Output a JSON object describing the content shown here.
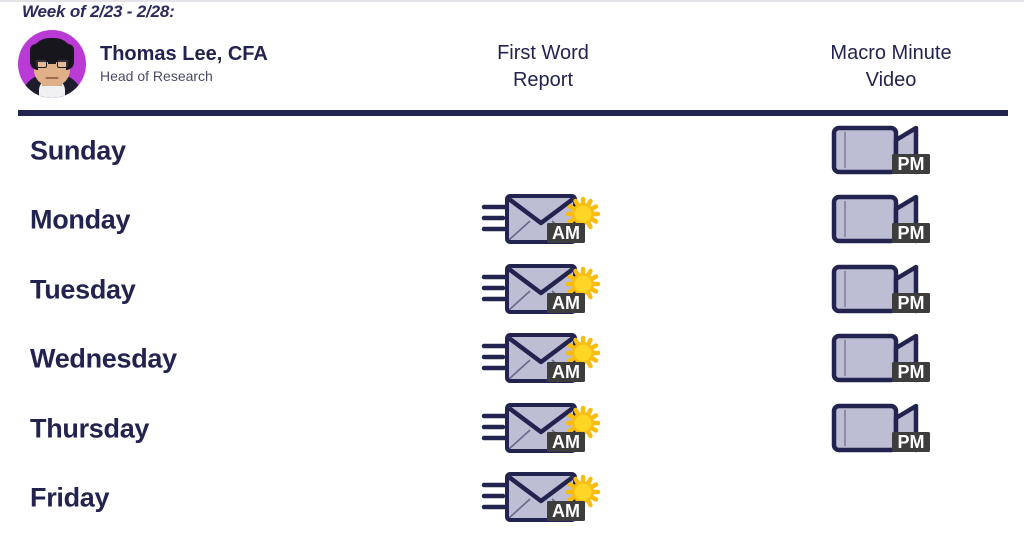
{
  "header": {
    "week_label": "Week of 2/23 - 2/28:",
    "analyst": {
      "name": "Thomas Lee, CFA",
      "title": "Head of Research",
      "avatar_icon": "analyst-avatar",
      "avatar_bg_color": "#b93ad4"
    },
    "columns": [
      {
        "id": "first-word-report",
        "label": "First Word\nReport"
      },
      {
        "id": "macro-minute-video",
        "label": "Macro Minute\nVideo"
      }
    ],
    "rule_color": "#23234f"
  },
  "icons": {
    "email_am": {
      "name": "email-am-icon",
      "badge": "AM",
      "accessory": "sun-icon",
      "envelope_fill": "#bdbdd4",
      "outline": "#23234f",
      "badge_bg": "#3d3d3d",
      "sun_color": "#fbbc10",
      "sun_center": "#ffd526"
    },
    "video_pm": {
      "name": "video-pm-icon",
      "badge": "PM",
      "accessory": "moon-icon",
      "camera_fill": "#bdbdd4",
      "outline": "#23234f",
      "badge_bg": "#3d3d3d",
      "moon_color": "#3fa9f5"
    }
  },
  "schedule": {
    "rows": [
      {
        "day": "Sunday",
        "first_word_report": false,
        "macro_minute_video": true
      },
      {
        "day": "Monday",
        "first_word_report": true,
        "macro_minute_video": true
      },
      {
        "day": "Tuesday",
        "first_word_report": true,
        "macro_minute_video": true
      },
      {
        "day": "Wednesday",
        "first_word_report": true,
        "macro_minute_video": true
      },
      {
        "day": "Thursday",
        "first_word_report": true,
        "macro_minute_video": true
      },
      {
        "day": "Friday",
        "first_word_report": true,
        "macro_minute_video": false
      }
    ]
  },
  "colors": {
    "navy": "#23234f",
    "text_muted": "#4a4a68",
    "background": "#ffffff"
  }
}
